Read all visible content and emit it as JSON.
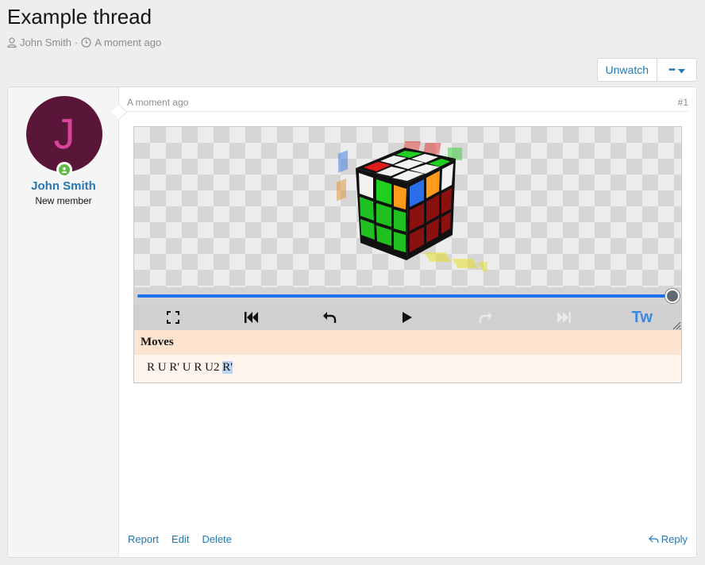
{
  "thread": {
    "title": "Example thread",
    "author": "John Smith",
    "separator": "·",
    "time": "A moment ago"
  },
  "toolbar": {
    "unwatch_label": "Unwatch",
    "more_label": "•••"
  },
  "post": {
    "date": "A moment ago",
    "number": "#1",
    "user": {
      "avatar_letter": "J",
      "name": "John Smith",
      "title": "New member",
      "avatar_color": "#5a1638",
      "avatar_letter_color": "#d9449a",
      "online_color": "#63b946"
    },
    "player": {
      "moves_heading": "Moves",
      "moves_prefix": "R U R' U R U2 ",
      "moves_current": "R'",
      "progress_fraction": 1.0,
      "twist_label": "Tw",
      "controls": [
        "fullscreen-icon",
        "skip-to-start-icon",
        "step-back-icon",
        "play-icon",
        "step-forward-icon",
        "skip-to-end-icon"
      ]
    },
    "actions": {
      "report": "Report",
      "edit": "Edit",
      "delete": "Delete",
      "reply": "Reply"
    }
  },
  "colors": {
    "link": "#2577b1",
    "scrubber": "#1f74ea"
  }
}
